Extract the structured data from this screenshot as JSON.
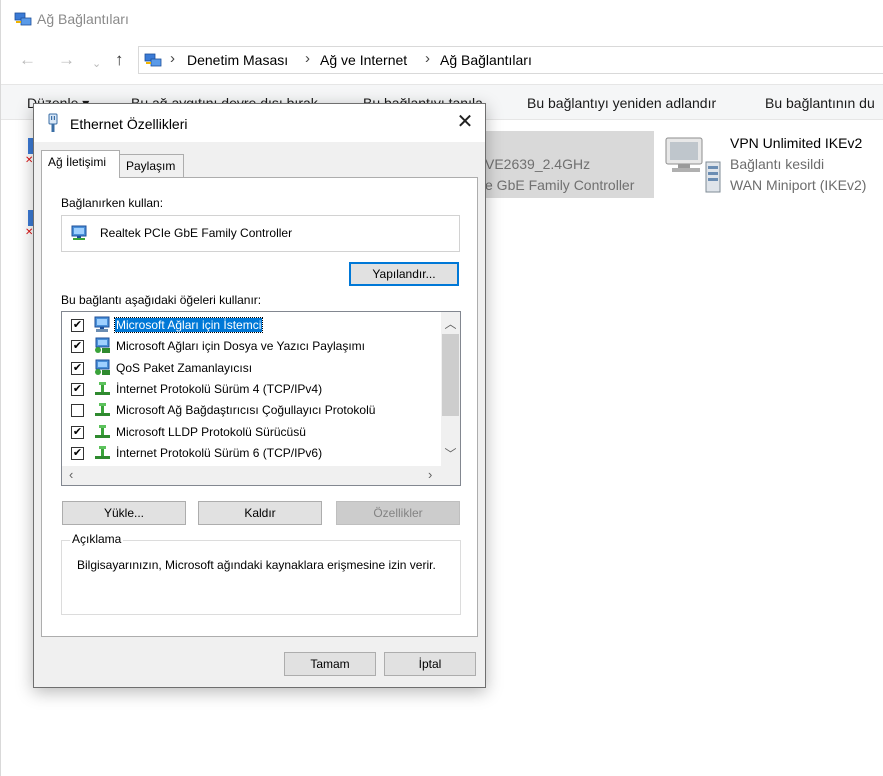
{
  "explorer": {
    "title": "Ağ Bağlantıları",
    "breadcrumb": [
      "Denetim Masası",
      "Ağ ve Internet",
      "Ağ Bağlantıları"
    ],
    "commands": [
      "Düzenle ▾",
      "Bu ağ aygıtını devre dışı bırak",
      "Bu bağlantıyı tanıla",
      "Bu bağlantıyı yeniden adlandır",
      "Bu bağlantının du"
    ],
    "selected_tile": {
      "line1": "VE2639_2.4GHz",
      "line2": "e GbE Family Controller"
    },
    "vpn_tile": {
      "name": "VPN Unlimited IKEv2",
      "status": "Bağlantı kesildi",
      "device": "WAN Miniport (IKEv2)"
    }
  },
  "dialog": {
    "title": "Ethernet Özellikleri",
    "close_glyph": "✕",
    "tabs": [
      "Ağ İletişimi",
      "Paylaşım"
    ],
    "connect_using_label": "Bağlanırken kullan:",
    "adapter_name": "Realtek PCIe GbE Family Controller",
    "configure_button": "Yapılandır...",
    "items_label": "Bu bağlantı aşağıdaki öğeleri kullanır:",
    "items": [
      {
        "label": "Microsoft Ağları için İstemci",
        "checked": "✔",
        "icon": "client-icon",
        "selected": true
      },
      {
        "label": "Microsoft Ağları için Dosya ve Yazıcı Paylaşımı",
        "checked": "✔",
        "icon": "service-icon",
        "selected": false
      },
      {
        "label": "QoS Paket Zamanlayıcısı",
        "checked": "✔",
        "icon": "service-icon",
        "selected": false
      },
      {
        "label": "İnternet Protokolü Sürüm 4 (TCP/IPv4)",
        "checked": "✔",
        "icon": "protocol-icon",
        "selected": false
      },
      {
        "label": "Microsoft Ağ Bağdaştırıcısı Çoğullayıcı Protokolü",
        "checked": "",
        "icon": "protocol-icon",
        "selected": false
      },
      {
        "label": "Microsoft LLDP Protokolü Sürücüsü",
        "checked": "✔",
        "icon": "protocol-icon",
        "selected": false
      },
      {
        "label": "İnternet Protokolü Sürüm 6 (TCP/IPv6)",
        "checked": "✔",
        "icon": "protocol-icon",
        "selected": false
      }
    ],
    "install_button": "Yükle...",
    "uninstall_button": "Kaldır",
    "properties_button": "Özellikler",
    "description_title": "Açıklama",
    "description_text": "Bilgisayarınızın, Microsoft ağındaki kaynaklara erişmesine izin verir.",
    "ok_button": "Tamam",
    "cancel_button": "İptal"
  },
  "colors": {
    "accent": "#0078d7",
    "dialog_bg": "#f0f0f0",
    "tile_selected": "#d9d9d9"
  }
}
